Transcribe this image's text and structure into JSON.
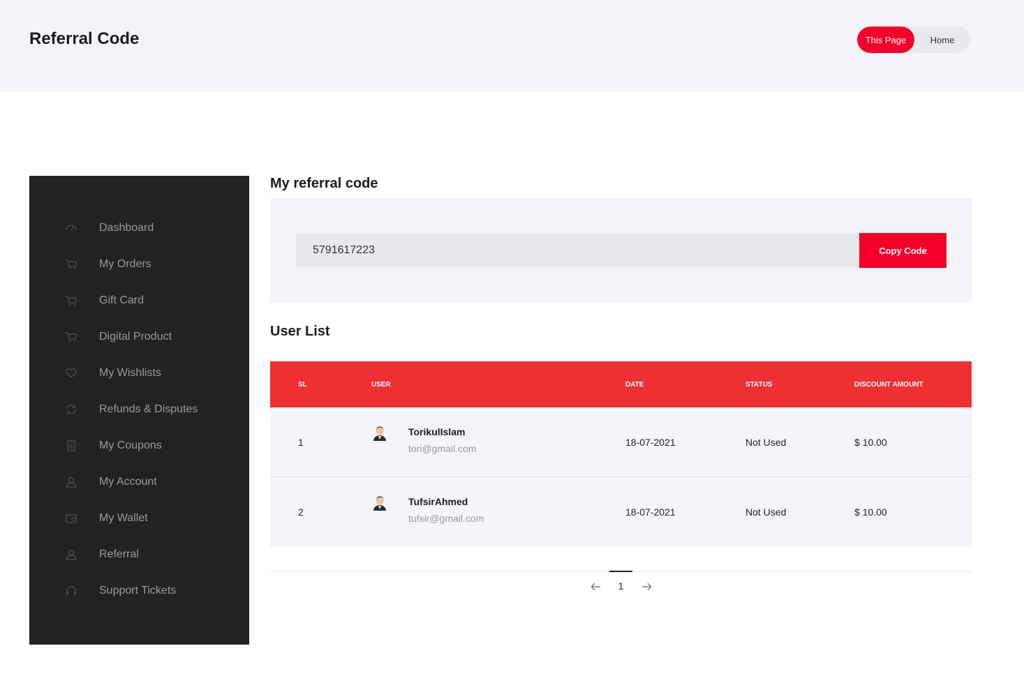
{
  "header": {
    "title": "Referral Code",
    "breadcrumb": {
      "active": "This Page",
      "home": "Home"
    }
  },
  "sidebar": {
    "items": [
      {
        "label": "Dashboard",
        "icon": "dashboard-icon"
      },
      {
        "label": "My Orders",
        "icon": "cart-icon"
      },
      {
        "label": "Gift Card",
        "icon": "cart-icon"
      },
      {
        "label": "Digital Product",
        "icon": "cart-icon"
      },
      {
        "label": "My Wishlists",
        "icon": "heart-icon"
      },
      {
        "label": "Refunds & Disputes",
        "icon": "refresh-icon"
      },
      {
        "label": "My Coupons",
        "icon": "coupon-icon"
      },
      {
        "label": "My Account",
        "icon": "user-icon"
      },
      {
        "label": "My Wallet",
        "icon": "wallet-icon"
      },
      {
        "label": "Referral",
        "icon": "user-icon"
      },
      {
        "label": "Support Tickets",
        "icon": "headset-icon"
      }
    ]
  },
  "referral": {
    "title": "My referral code",
    "code": "5791617223",
    "copy_label": "Copy Code"
  },
  "user_list": {
    "title": "User List",
    "columns": [
      "SL",
      "USER",
      "DATE",
      "STATUS",
      "DISCOUNT AMOUNT"
    ],
    "rows": [
      {
        "sl": "1",
        "name": "TorikulIslam",
        "email": "tori@gmail.com",
        "date": "18-07-2021",
        "status": "Not Used",
        "amount": "$ 10.00"
      },
      {
        "sl": "2",
        "name": "TufsirAhmed",
        "email": "tufsir@gmail.com",
        "date": "18-07-2021",
        "status": "Not Used",
        "amount": "$ 10.00"
      }
    ]
  },
  "pagination": {
    "current": "1"
  },
  "colors": {
    "accent": "#f4002b",
    "table_header": "#ef3033",
    "sidebar_bg": "#222222",
    "panel_bg": "#f3f5f8"
  }
}
